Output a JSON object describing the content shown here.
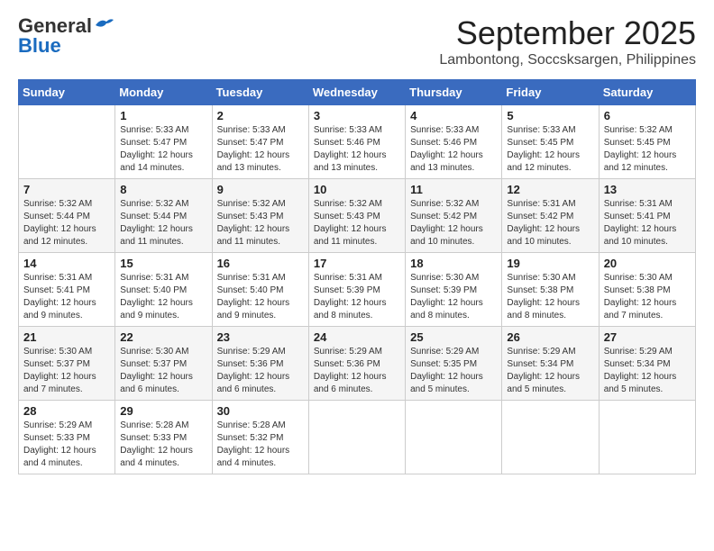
{
  "logo": {
    "general": "General",
    "blue": "Blue"
  },
  "title": "September 2025",
  "location": "Lambontong, Soccsksargen, Philippines",
  "weekdays": [
    "Sunday",
    "Monday",
    "Tuesday",
    "Wednesday",
    "Thursday",
    "Friday",
    "Saturday"
  ],
  "weeks": [
    [
      {
        "day": "",
        "info": ""
      },
      {
        "day": "1",
        "info": "Sunrise: 5:33 AM\nSunset: 5:47 PM\nDaylight: 12 hours\nand 14 minutes."
      },
      {
        "day": "2",
        "info": "Sunrise: 5:33 AM\nSunset: 5:47 PM\nDaylight: 12 hours\nand 13 minutes."
      },
      {
        "day": "3",
        "info": "Sunrise: 5:33 AM\nSunset: 5:46 PM\nDaylight: 12 hours\nand 13 minutes."
      },
      {
        "day": "4",
        "info": "Sunrise: 5:33 AM\nSunset: 5:46 PM\nDaylight: 12 hours\nand 13 minutes."
      },
      {
        "day": "5",
        "info": "Sunrise: 5:33 AM\nSunset: 5:45 PM\nDaylight: 12 hours\nand 12 minutes."
      },
      {
        "day": "6",
        "info": "Sunrise: 5:32 AM\nSunset: 5:45 PM\nDaylight: 12 hours\nand 12 minutes."
      }
    ],
    [
      {
        "day": "7",
        "info": "Sunrise: 5:32 AM\nSunset: 5:44 PM\nDaylight: 12 hours\nand 12 minutes."
      },
      {
        "day": "8",
        "info": "Sunrise: 5:32 AM\nSunset: 5:44 PM\nDaylight: 12 hours\nand 11 minutes."
      },
      {
        "day": "9",
        "info": "Sunrise: 5:32 AM\nSunset: 5:43 PM\nDaylight: 12 hours\nand 11 minutes."
      },
      {
        "day": "10",
        "info": "Sunrise: 5:32 AM\nSunset: 5:43 PM\nDaylight: 12 hours\nand 11 minutes."
      },
      {
        "day": "11",
        "info": "Sunrise: 5:32 AM\nSunset: 5:42 PM\nDaylight: 12 hours\nand 10 minutes."
      },
      {
        "day": "12",
        "info": "Sunrise: 5:31 AM\nSunset: 5:42 PM\nDaylight: 12 hours\nand 10 minutes."
      },
      {
        "day": "13",
        "info": "Sunrise: 5:31 AM\nSunset: 5:41 PM\nDaylight: 12 hours\nand 10 minutes."
      }
    ],
    [
      {
        "day": "14",
        "info": "Sunrise: 5:31 AM\nSunset: 5:41 PM\nDaylight: 12 hours\nand 9 minutes."
      },
      {
        "day": "15",
        "info": "Sunrise: 5:31 AM\nSunset: 5:40 PM\nDaylight: 12 hours\nand 9 minutes."
      },
      {
        "day": "16",
        "info": "Sunrise: 5:31 AM\nSunset: 5:40 PM\nDaylight: 12 hours\nand 9 minutes."
      },
      {
        "day": "17",
        "info": "Sunrise: 5:31 AM\nSunset: 5:39 PM\nDaylight: 12 hours\nand 8 minutes."
      },
      {
        "day": "18",
        "info": "Sunrise: 5:30 AM\nSunset: 5:39 PM\nDaylight: 12 hours\nand 8 minutes."
      },
      {
        "day": "19",
        "info": "Sunrise: 5:30 AM\nSunset: 5:38 PM\nDaylight: 12 hours\nand 8 minutes."
      },
      {
        "day": "20",
        "info": "Sunrise: 5:30 AM\nSunset: 5:38 PM\nDaylight: 12 hours\nand 7 minutes."
      }
    ],
    [
      {
        "day": "21",
        "info": "Sunrise: 5:30 AM\nSunset: 5:37 PM\nDaylight: 12 hours\nand 7 minutes."
      },
      {
        "day": "22",
        "info": "Sunrise: 5:30 AM\nSunset: 5:37 PM\nDaylight: 12 hours\nand 6 minutes."
      },
      {
        "day": "23",
        "info": "Sunrise: 5:29 AM\nSunset: 5:36 PM\nDaylight: 12 hours\nand 6 minutes."
      },
      {
        "day": "24",
        "info": "Sunrise: 5:29 AM\nSunset: 5:36 PM\nDaylight: 12 hours\nand 6 minutes."
      },
      {
        "day": "25",
        "info": "Sunrise: 5:29 AM\nSunset: 5:35 PM\nDaylight: 12 hours\nand 5 minutes."
      },
      {
        "day": "26",
        "info": "Sunrise: 5:29 AM\nSunset: 5:34 PM\nDaylight: 12 hours\nand 5 minutes."
      },
      {
        "day": "27",
        "info": "Sunrise: 5:29 AM\nSunset: 5:34 PM\nDaylight: 12 hours\nand 5 minutes."
      }
    ],
    [
      {
        "day": "28",
        "info": "Sunrise: 5:29 AM\nSunset: 5:33 PM\nDaylight: 12 hours\nand 4 minutes."
      },
      {
        "day": "29",
        "info": "Sunrise: 5:28 AM\nSunset: 5:33 PM\nDaylight: 12 hours\nand 4 minutes."
      },
      {
        "day": "30",
        "info": "Sunrise: 5:28 AM\nSunset: 5:32 PM\nDaylight: 12 hours\nand 4 minutes."
      },
      {
        "day": "",
        "info": ""
      },
      {
        "day": "",
        "info": ""
      },
      {
        "day": "",
        "info": ""
      },
      {
        "day": "",
        "info": ""
      }
    ]
  ]
}
